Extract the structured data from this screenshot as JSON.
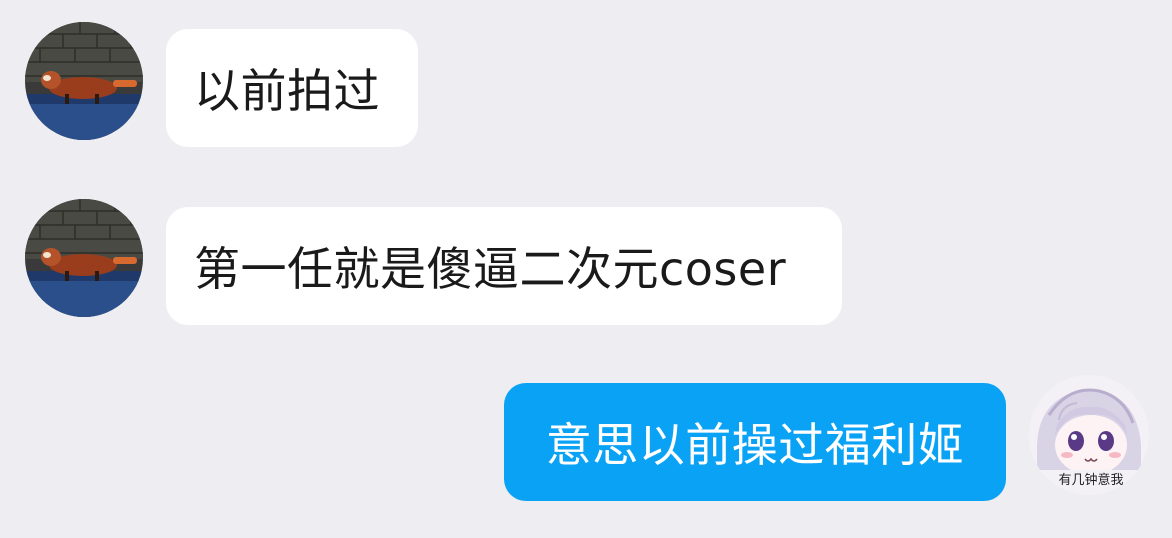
{
  "chat": {
    "messages": [
      {
        "direction": "incoming",
        "text": "以前拍过",
        "avatar_icon": "red-panda-avatar-icon"
      },
      {
        "direction": "incoming",
        "text": "第一任就是傻逼二次元coser",
        "avatar_icon": "red-panda-avatar-icon"
      },
      {
        "direction": "outgoing",
        "text": "意思以前操过福利姬",
        "avatar_icon": "anime-girl-avatar-icon",
        "avatar_caption": "有几钟意我"
      }
    ]
  },
  "colors": {
    "background": "#ededf2",
    "incoming_bubble": "#ffffff",
    "outgoing_bubble": "#0aa2f5",
    "incoming_text": "#1a1a1a",
    "outgoing_text": "#ffffff"
  }
}
